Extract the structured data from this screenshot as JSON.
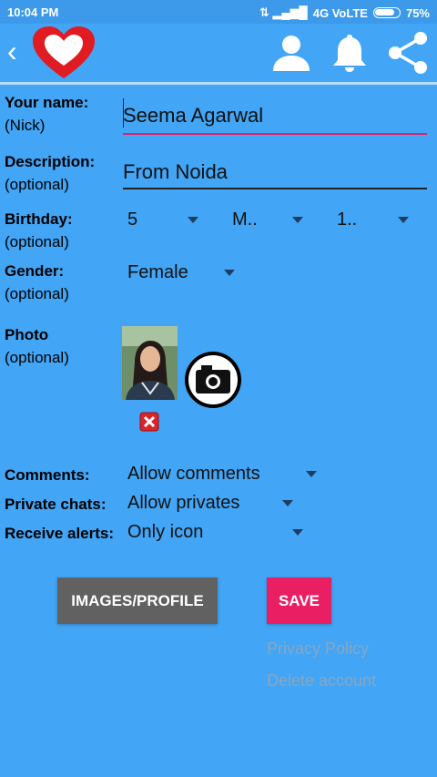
{
  "status": {
    "time": "10:04 PM",
    "network": "4G VoLTE",
    "battery": "75%"
  },
  "toolbar": {
    "back_icon": "chevron-left-icon",
    "logo_icon": "heart-logo",
    "user_icon": "user-icon",
    "bell_icon": "bell-icon",
    "share_icon": "share-icon"
  },
  "form": {
    "name": {
      "label": "Your name:",
      "sub": "(Nick)",
      "value": "Seema Agarwal"
    },
    "description": {
      "label": "Description:",
      "sub": "(optional)",
      "value": "From Noida"
    },
    "birthday": {
      "label": "Birthday:",
      "sub": "(optional)",
      "day": "5",
      "month": "M..",
      "year": "1.."
    },
    "gender": {
      "label": "Gender:",
      "sub": "(optional)",
      "value": "Female"
    },
    "photo": {
      "label": "Photo",
      "sub": "(optional)"
    },
    "comments": {
      "label": "Comments:",
      "value": "Allow comments"
    },
    "private_chats": {
      "label": "Private chats:",
      "value": "Allow privates"
    },
    "receive_alerts": {
      "label": "Receive alerts:",
      "value": "Only icon"
    }
  },
  "buttons": {
    "images_profile": "IMAGES/PROFILE",
    "save": "SAVE"
  },
  "links": {
    "privacy": "Privacy Policy",
    "delete": "Delete account"
  },
  "colors": {
    "background": "#42a5f5",
    "save": "#e91e63",
    "images": "#616161",
    "accent_underline": "#e91e63"
  }
}
